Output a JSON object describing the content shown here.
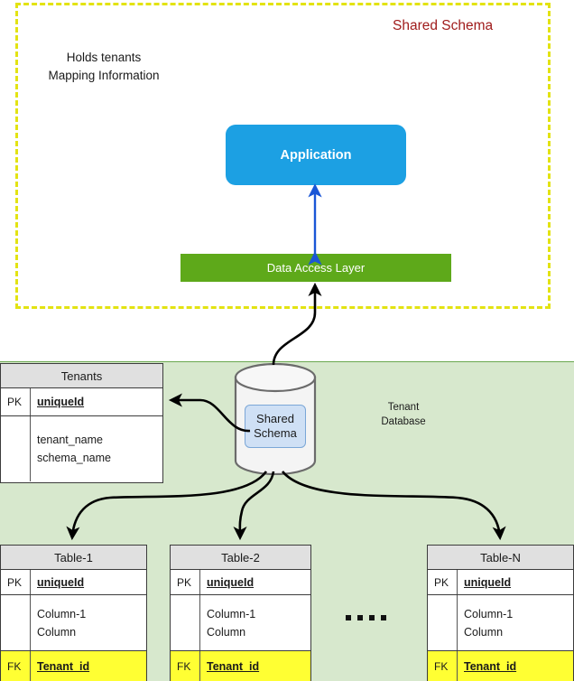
{
  "diagram": {
    "region_title": "Shared Schema",
    "note": "Holds tenants\nMapping Information",
    "note_line1": "Holds tenants",
    "note_line2": "Mapping Information",
    "application_label": "Application",
    "data_access_layer_label": "Data Access Layer",
    "database_region_label_line1": "Tenant",
    "database_region_label_line2": "Database",
    "cylinder_label_line1": "Shared",
    "cylinder_label_line2": "Schema",
    "ellipsis": "■ ■ ■ ■"
  },
  "colors": {
    "dashed_border": "#e3e312",
    "region_title": "#a01c1c",
    "application": "#1ca0e3",
    "data_access_layer": "#5ea91a",
    "database_region": "#d7e8cd",
    "database_region_border": "#6aa84f",
    "cylinder_label_fill": "#cfe0f5",
    "cylinder_label_border": "#7ba7d7",
    "table_header": "#e0e0e0",
    "foreign_key_row": "#ffff33",
    "arrow_blue": "#1a56d6",
    "arrow_black": "#000000"
  },
  "tenants_table": {
    "title": "Tenants",
    "pk_label": "PK",
    "pk_field": "uniqueId",
    "fields": [
      "tenant_name",
      "schema_name"
    ]
  },
  "tables": [
    {
      "title": "Table-1",
      "pk_label": "PK",
      "pk_field": "uniqueId",
      "fields": [
        "Column-1",
        "Column"
      ],
      "fk_label": "FK",
      "fk_field": "Tenant_id"
    },
    {
      "title": "Table-2",
      "pk_label": "PK",
      "pk_field": "uniqueId",
      "fields": [
        "Column-1",
        "Column"
      ],
      "fk_label": "FK",
      "fk_field": "Tenant_id"
    },
    {
      "title": "Table-N",
      "pk_label": "PK",
      "pk_field": "uniqueId",
      "fields": [
        "Column-1",
        "Column"
      ],
      "fk_label": "FK",
      "fk_field": "Tenant_id"
    }
  ]
}
